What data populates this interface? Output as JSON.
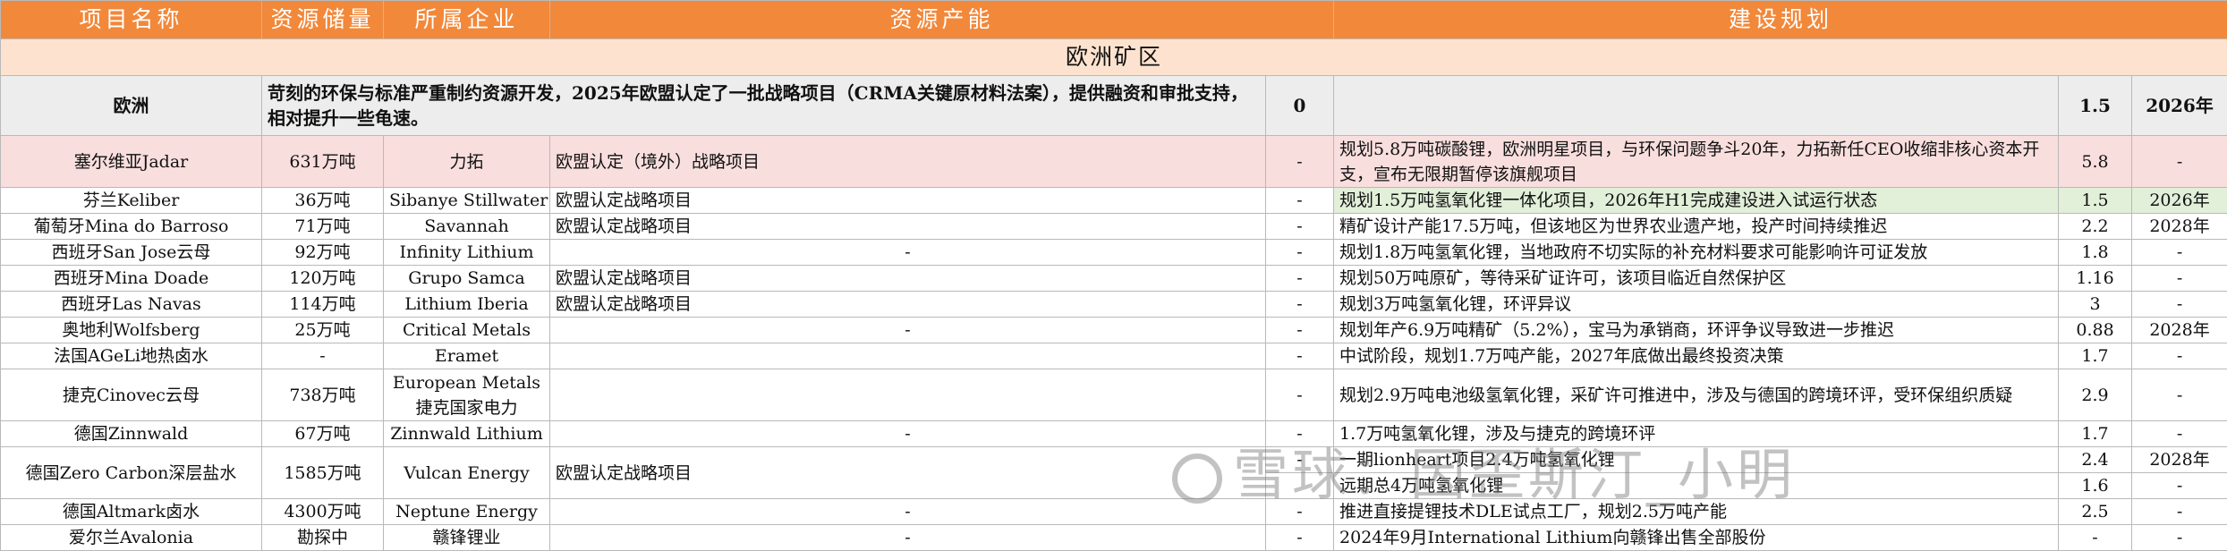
{
  "headers": [
    "项目名称",
    "资源储量",
    "所属企业",
    "资源产能",
    "建设规划"
  ],
  "region": "欧洲矿区",
  "summary": {
    "name": "欧洲",
    "desc": "苛刻的环保与标准严重制约资源开发，2025年欧盟认定了一批战略项目（CRMA关键原材料法案），提供融资和审批支持，相对提升一些龟速。",
    "capacity": "0",
    "value": "1.5",
    "year": "2026年"
  },
  "rows": [
    {
      "name": "塞尔维亚Jadar",
      "reserve": "631万吨",
      "company": "力拓",
      "status": "欧盟认定（境外）战略项目",
      "cap": "-",
      "plan": "规划5.8万吨碳酸锂，欧洲明星项目，与环保问题争斗20年，力拓新任CEO收缩非核心资本开支，宣布无限期暂停该旗舰项目",
      "value": "5.8",
      "year": "-"
    },
    {
      "name": "芬兰Keliber",
      "reserve": "36万吨",
      "company": "Sibanye Stillwater",
      "status": "欧盟认定战略项目",
      "cap": "-",
      "plan": "规划1.5万吨氢氧化锂一体化项目，2026年H1完成建设进入试运行状态",
      "value": "1.5",
      "year": "2026年"
    },
    {
      "name": "葡萄牙Mina do Barroso",
      "reserve": "71万吨",
      "company": "Savannah",
      "status": "欧盟认定战略项目",
      "cap": "-",
      "plan": "精矿设计产能17.5万吨，但该地区为世界农业遗产地，投产时间持续推迟",
      "value": "2.2",
      "year": "2028年"
    },
    {
      "name": "西班牙San Jose云母",
      "reserve": "92万吨",
      "company": "Infinity Lithium",
      "status": "-",
      "cap": "-",
      "plan": "规划1.8万吨氢氧化锂，当地政府不切实际的补充材料要求可能影响许可证发放",
      "value": "1.8",
      "year": "-"
    },
    {
      "name": "西班牙Mina Doade",
      "reserve": "120万吨",
      "company": "Grupo Samca",
      "status": "欧盟认定战略项目",
      "cap": "-",
      "plan": "规划50万吨原矿，等待采矿证许可，该项目临近自然保护区",
      "value": "1.16",
      "year": "-"
    },
    {
      "name": "西班牙Las Navas",
      "reserve": "114万吨",
      "company": "Lithium Iberia",
      "status": "欧盟认定战略项目",
      "cap": "-",
      "plan": "规划3万吨氢氧化锂，环评异议",
      "value": "3",
      "year": "-"
    },
    {
      "name": "奥地利Wolfsberg",
      "reserve": "25万吨",
      "company": "Critical Metals",
      "status": "-",
      "cap": "-",
      "plan": "规划年产6.9万吨精矿（5.2%），宝马为承销商，环评争议导致进一步推迟",
      "value": "0.88",
      "year": "2028年"
    },
    {
      "name": "法国AGeLi地热卤水",
      "reserve": "-",
      "company": "Eramet",
      "status": "",
      "cap": "-",
      "plan": "中试阶段，规划1.7万吨产能，2027年底做出最终投资决策",
      "value": "1.7",
      "year": "-"
    },
    {
      "name": "捷克Cinovec云母",
      "reserve": "738万吨",
      "company": "European Metals 捷克国家电力",
      "status": "",
      "cap": "-",
      "plan": "规划2.9万吨电池级氢氧化锂，采矿许可推进中，涉及与德国的跨境环评，受环保组织质疑",
      "value": "2.9",
      "year": "-"
    },
    {
      "name": "德国Zinnwald",
      "reserve": "67万吨",
      "company": "Zinnwald Lithium",
      "status": "-",
      "cap": "-",
      "plan": "1.7万吨氢氧化锂，涉及与捷克的跨境环评",
      "value": "1.7",
      "year": "-"
    },
    {
      "name": "德国Zero Carbon深层盐水",
      "reserve": "1585万吨",
      "company": "Vulcan Energy",
      "status": "欧盟认定战略项目",
      "cap": "-",
      "plan": "一期lionheart项目2.4万吨氢氧化锂",
      "plan2": "远期总4万吨氢氧化锂",
      "value": "2.4",
      "value2": "1.6",
      "year": "2028年",
      "year2": "-"
    },
    {
      "name": "德国Altmark卤水",
      "reserve": "4300万吨",
      "company": "Neptune Energy",
      "status": "-",
      "cap": "-",
      "plan": "推进直接提锂技术DLE试点工厂，规划2.5万吨产能",
      "value": "2.5",
      "year": "-"
    },
    {
      "name": "爱尔兰Avalonia",
      "reserve": "勘探中",
      "company": "赣锋锂业",
      "status": "-",
      "cap": "-",
      "plan": "2024年9月International Lithium向赣锋出售全部股份",
      "value": "-",
      "year": "-"
    }
  ],
  "watermark": "雪球：因歪斯汀_小明"
}
